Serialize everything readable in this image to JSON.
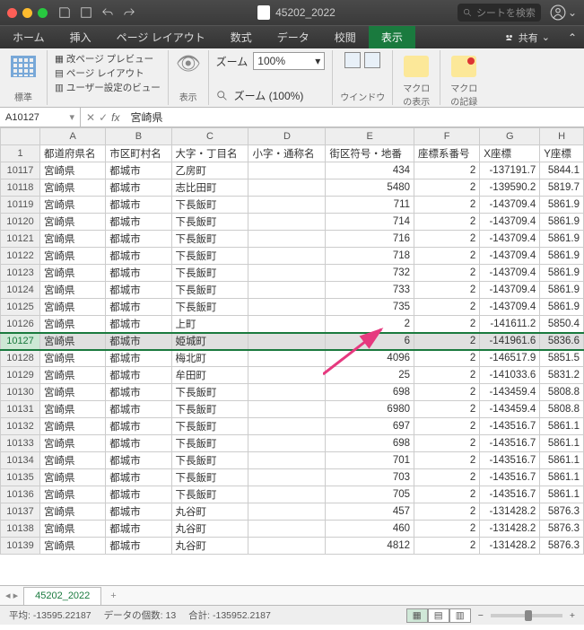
{
  "title": "45202_2022",
  "search_placeholder": "シートを検索",
  "menu": {
    "home": "ホーム",
    "insert": "挿入",
    "layout": "ページ レイアウト",
    "formula": "数式",
    "data": "データ",
    "review": "校閲",
    "view": "表示",
    "share": "共有"
  },
  "ribbon": {
    "normal": "標準",
    "pageBreak": "改ページ プレビュー",
    "pageLayout": "ページ レイアウト",
    "userView": "ユーザー設定のビュー",
    "viewLabel": "表示",
    "zoom": "ズーム",
    "zoomVal": "100%",
    "zoom100": "ズーム (100%)",
    "window": "ウインドウ",
    "macroShow": "マクロ\nの表示",
    "macroRec": "マクロ\nの記録"
  },
  "namebox": "A10127",
  "fxval": "宮崎県",
  "cols": [
    "A",
    "B",
    "C",
    "D",
    "E",
    "F",
    "G",
    "H"
  ],
  "headers": [
    "都道府県名",
    "市区町村名",
    "大字・丁目名",
    "小字・通称名",
    "街区符号・地番",
    "座標系番号",
    "X座標",
    "Y座標"
  ],
  "selRow": "10127",
  "rows": [
    {
      "n": "10117",
      "c": [
        "宮崎県",
        "都城市",
        "乙房町",
        "",
        "434",
        "2",
        "-137191.7",
        "5844.1"
      ]
    },
    {
      "n": "10118",
      "c": [
        "宮崎県",
        "都城市",
        "志比田町",
        "",
        "5480",
        "2",
        "-139590.2",
        "5819.7"
      ]
    },
    {
      "n": "10119",
      "c": [
        "宮崎県",
        "都城市",
        "下長飯町",
        "",
        "711",
        "2",
        "-143709.4",
        "5861.9"
      ]
    },
    {
      "n": "10120",
      "c": [
        "宮崎県",
        "都城市",
        "下長飯町",
        "",
        "714",
        "2",
        "-143709.4",
        "5861.9"
      ]
    },
    {
      "n": "10121",
      "c": [
        "宮崎県",
        "都城市",
        "下長飯町",
        "",
        "716",
        "2",
        "-143709.4",
        "5861.9"
      ]
    },
    {
      "n": "10122",
      "c": [
        "宮崎県",
        "都城市",
        "下長飯町",
        "",
        "718",
        "2",
        "-143709.4",
        "5861.9"
      ]
    },
    {
      "n": "10123",
      "c": [
        "宮崎県",
        "都城市",
        "下長飯町",
        "",
        "732",
        "2",
        "-143709.4",
        "5861.9"
      ]
    },
    {
      "n": "10124",
      "c": [
        "宮崎県",
        "都城市",
        "下長飯町",
        "",
        "733",
        "2",
        "-143709.4",
        "5861.9"
      ]
    },
    {
      "n": "10125",
      "c": [
        "宮崎県",
        "都城市",
        "下長飯町",
        "",
        "735",
        "2",
        "-143709.4",
        "5861.9"
      ]
    },
    {
      "n": "10126",
      "c": [
        "宮崎県",
        "都城市",
        "上町",
        "",
        "2",
        "2",
        "-141611.2",
        "5850.4"
      ]
    },
    {
      "n": "10127",
      "c": [
        "宮崎県",
        "都城市",
        "姫城町",
        "",
        "6",
        "2",
        "-141961.6",
        "5836.6"
      ]
    },
    {
      "n": "10128",
      "c": [
        "宮崎県",
        "都城市",
        "梅北町",
        "",
        "4096",
        "2",
        "-146517.9",
        "5851.5"
      ]
    },
    {
      "n": "10129",
      "c": [
        "宮崎県",
        "都城市",
        "牟田町",
        "",
        "25",
        "2",
        "-141033.6",
        "5831.2"
      ]
    },
    {
      "n": "10130",
      "c": [
        "宮崎県",
        "都城市",
        "下長飯町",
        "",
        "698",
        "2",
        "-143459.4",
        "5808.8"
      ]
    },
    {
      "n": "10131",
      "c": [
        "宮崎県",
        "都城市",
        "下長飯町",
        "",
        "6980",
        "2",
        "-143459.4",
        "5808.8"
      ]
    },
    {
      "n": "10132",
      "c": [
        "宮崎県",
        "都城市",
        "下長飯町",
        "",
        "697",
        "2",
        "-143516.7",
        "5861.1"
      ]
    },
    {
      "n": "10133",
      "c": [
        "宮崎県",
        "都城市",
        "下長飯町",
        "",
        "698",
        "2",
        "-143516.7",
        "5861.1"
      ]
    },
    {
      "n": "10134",
      "c": [
        "宮崎県",
        "都城市",
        "下長飯町",
        "",
        "701",
        "2",
        "-143516.7",
        "5861.1"
      ]
    },
    {
      "n": "10135",
      "c": [
        "宮崎県",
        "都城市",
        "下長飯町",
        "",
        "703",
        "2",
        "-143516.7",
        "5861.1"
      ]
    },
    {
      "n": "10136",
      "c": [
        "宮崎県",
        "都城市",
        "下長飯町",
        "",
        "705",
        "2",
        "-143516.7",
        "5861.1"
      ]
    },
    {
      "n": "10137",
      "c": [
        "宮崎県",
        "都城市",
        "丸谷町",
        "",
        "457",
        "2",
        "-131428.2",
        "5876.3"
      ]
    },
    {
      "n": "10138",
      "c": [
        "宮崎県",
        "都城市",
        "丸谷町",
        "",
        "460",
        "2",
        "-131428.2",
        "5876.3"
      ]
    },
    {
      "n": "10139",
      "c": [
        "宮崎県",
        "都城市",
        "丸谷町",
        "",
        "4812",
        "2",
        "-131428.2",
        "5876.3"
      ]
    }
  ],
  "tab": "45202_2022",
  "status": {
    "avg": "平均:  -13595.22187",
    "cnt": "データの個数: 13",
    "sum": "合計: -135952.2187"
  }
}
